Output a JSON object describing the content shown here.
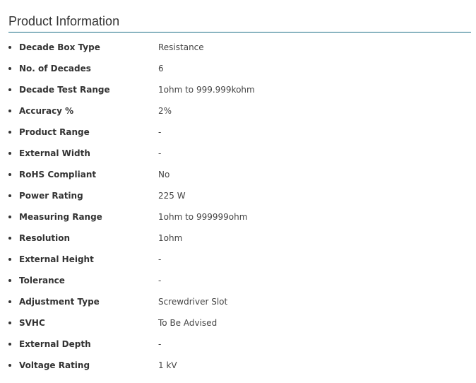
{
  "section": {
    "title": "Product Information"
  },
  "specs": [
    {
      "label": "Decade Box Type",
      "value": "Resistance"
    },
    {
      "label": "No. of Decades",
      "value": "6"
    },
    {
      "label": "Decade Test Range",
      "value": "1ohm to 999.999kohm"
    },
    {
      "label": "Accuracy %",
      "value": "2%"
    },
    {
      "label": "Product Range",
      "value": "-"
    },
    {
      "label": "External Width",
      "value": "-"
    },
    {
      "label": "RoHS Compliant",
      "value": "No"
    },
    {
      "label": "Power Rating",
      "value": "225 W"
    },
    {
      "label": "Measuring Range",
      "value": "1ohm to 999999ohm"
    },
    {
      "label": "Resolution",
      "value": "1ohm"
    },
    {
      "label": "External Height",
      "value": "-"
    },
    {
      "label": "Tolerance",
      "value": "-"
    },
    {
      "label": "Adjustment Type",
      "value": "Screwdriver Slot"
    },
    {
      "label": "SVHC",
      "value": "To Be Advised"
    },
    {
      "label": "External Depth",
      "value": "-"
    },
    {
      "label": "Voltage Rating",
      "value": "1 kV"
    }
  ],
  "colors": {
    "title_underline": "#1b6d85",
    "text": "#333333"
  }
}
